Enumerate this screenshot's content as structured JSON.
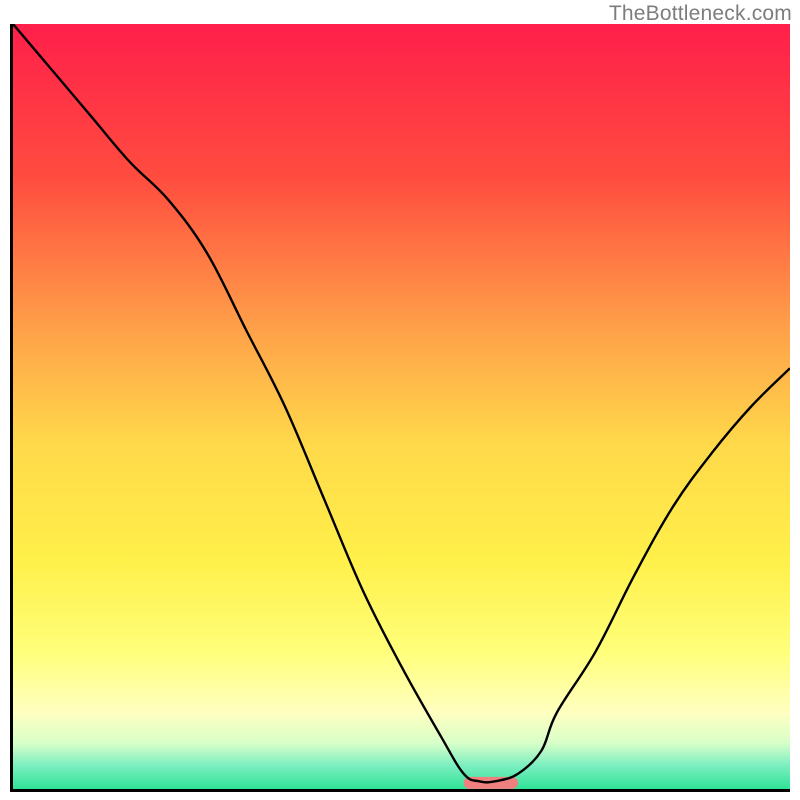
{
  "watermark": "TheBottleneck.com",
  "chart_data": {
    "type": "line",
    "title": "",
    "xlabel": "",
    "ylabel": "",
    "xlim": [
      0,
      100
    ],
    "ylim": [
      0,
      100
    ],
    "x": [
      0,
      5,
      10,
      15,
      20,
      25,
      30,
      35,
      40,
      45,
      50,
      55,
      58,
      60,
      62,
      65,
      68,
      70,
      75,
      80,
      85,
      90,
      95,
      100
    ],
    "values": [
      100,
      94,
      88,
      82,
      77,
      70,
      60,
      50,
      38,
      26,
      16,
      7,
      2,
      1,
      1,
      2,
      5,
      10,
      18,
      28,
      37,
      44,
      50,
      55
    ],
    "marker": {
      "x_range": [
        58,
        65
      ],
      "y": 0.8,
      "color": "#f08080"
    },
    "background_gradient": {
      "stops": [
        {
          "offset": 0.0,
          "color": "#ff1f4b"
        },
        {
          "offset": 0.2,
          "color": "#ff4c3f"
        },
        {
          "offset": 0.4,
          "color": "#ffa149"
        },
        {
          "offset": 0.55,
          "color": "#ffd94a"
        },
        {
          "offset": 0.7,
          "color": "#fff04a"
        },
        {
          "offset": 0.82,
          "color": "#ffff7a"
        },
        {
          "offset": 0.9,
          "color": "#ffffc0"
        },
        {
          "offset": 0.94,
          "color": "#d8ffc8"
        },
        {
          "offset": 0.97,
          "color": "#7aeec0"
        },
        {
          "offset": 1.0,
          "color": "#2fe396"
        }
      ]
    }
  }
}
